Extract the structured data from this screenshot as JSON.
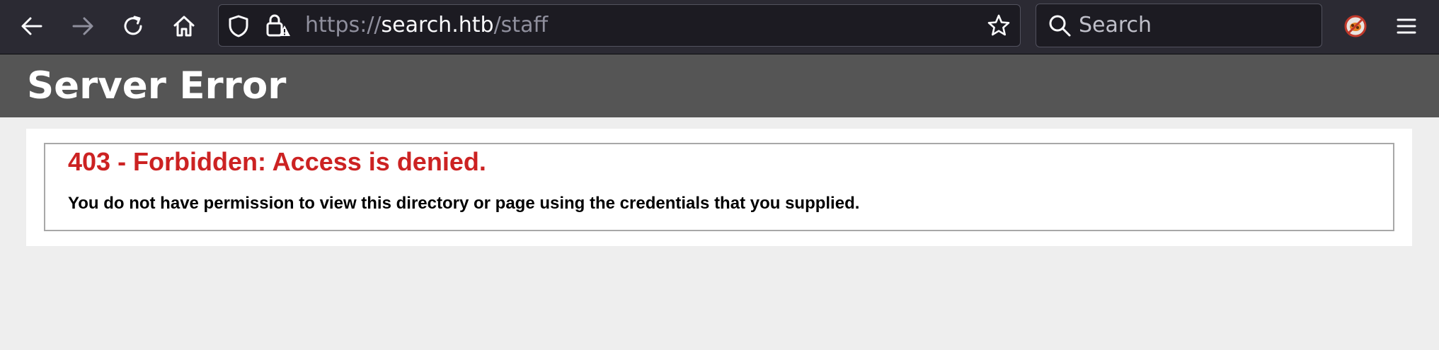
{
  "browser": {
    "url": {
      "scheme": "https://",
      "host": "search.htb",
      "path": "/staff"
    },
    "search_placeholder": "Search",
    "icons": {
      "back": "back-arrow-icon",
      "forward": "forward-arrow-icon",
      "reload": "reload-icon",
      "home": "home-icon",
      "tracking_protection": "shield-icon",
      "security": "lock-warning-icon",
      "bookmark": "star-icon",
      "search": "magnifier-icon",
      "extension": "extension-icon",
      "menu": "hamburger-menu-icon"
    },
    "colors": {
      "toolbar_bg": "#2b2a33",
      "field_bg": "#1c1b22",
      "icon": "#fbfbfe",
      "icon_disabled": "#8f8f9d"
    }
  },
  "page": {
    "header_title": "Server Error",
    "error_title": "403 - Forbidden: Access is denied.",
    "error_message": "You do not have permission to view this directory or page using the credentials that you supplied.",
    "colors": {
      "header_bg": "#555555",
      "error_title": "#cc2222",
      "page_bg": "#eeeeee"
    }
  }
}
